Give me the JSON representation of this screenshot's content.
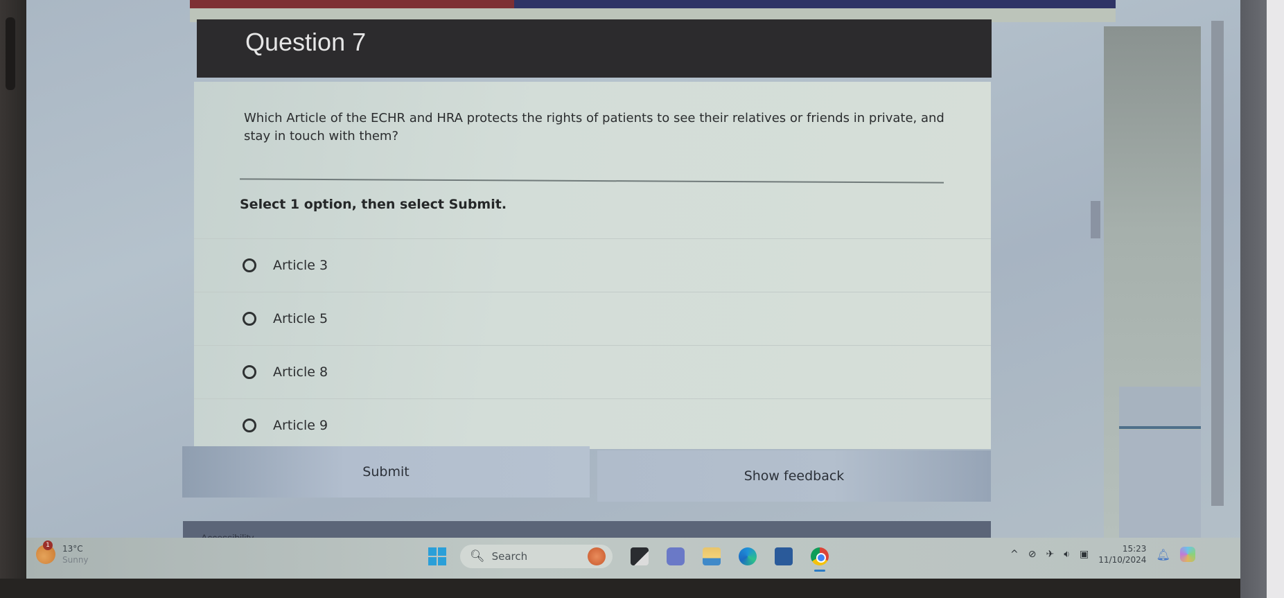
{
  "quiz": {
    "progress_fraction": 0.35,
    "question_title": "Question 7",
    "question_text": "Which Article of the ECHR and HRA protects the rights of patients to see their relatives or friends in private, and stay in touch with them?",
    "instruction": "Select 1 option, then select Submit.",
    "options": [
      {
        "label": "Article 3",
        "selected": false
      },
      {
        "label": "Article 5",
        "selected": false
      },
      {
        "label": "Article 8",
        "selected": false
      },
      {
        "label": "Article 9",
        "selected": false
      }
    ],
    "submit_label": "Submit",
    "feedback_label": "Show feedback",
    "accessibility_label": "Accessibility"
  },
  "taskbar": {
    "weather": {
      "temperature": "13°C",
      "condition": "Sunny",
      "badge": "1",
      "icon": "weather-sun-icon"
    },
    "search_placeholder": "Search",
    "pinned_apps": [
      {
        "name": "app-l-icon"
      },
      {
        "name": "teams-icon"
      },
      {
        "name": "file-explorer-icon"
      },
      {
        "name": "edge-icon"
      },
      {
        "name": "microsoft-store-icon"
      },
      {
        "name": "chrome-icon",
        "active": true
      }
    ],
    "tray": {
      "chevron": "^",
      "time": "15:23",
      "date": "11/10/2024"
    }
  },
  "colors": {
    "progress_fill": "#7e3034",
    "progress_track": "#2f3466",
    "header_bg": "#2c2b2d",
    "card_bg": "#d3ddd8",
    "button_bg": "#b2bece"
  }
}
